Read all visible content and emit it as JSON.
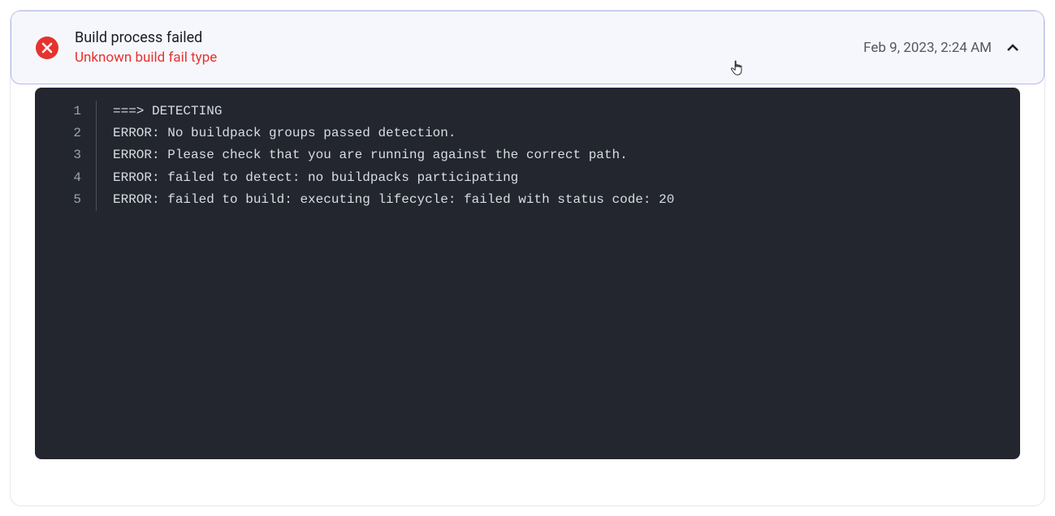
{
  "header": {
    "title": "Build process failed",
    "subtitle": "Unknown build fail type",
    "timestamp": "Feb 9, 2023, 2:24 AM"
  },
  "log": {
    "lines": [
      {
        "n": "1",
        "text": "===> DETECTING"
      },
      {
        "n": "2",
        "text": "ERROR: No buildpack groups passed detection."
      },
      {
        "n": "3",
        "text": "ERROR: Please check that you are running against the correct path."
      },
      {
        "n": "4",
        "text": "ERROR: failed to detect: no buildpacks participating"
      },
      {
        "n": "5",
        "text": "ERROR: failed to build: executing lifecycle: failed with status code: 20"
      }
    ]
  },
  "colors": {
    "error": "#e5332e",
    "panel_bg": "#f6f7fc",
    "panel_border": "#b9b5f2",
    "log_bg": "#23262f"
  }
}
